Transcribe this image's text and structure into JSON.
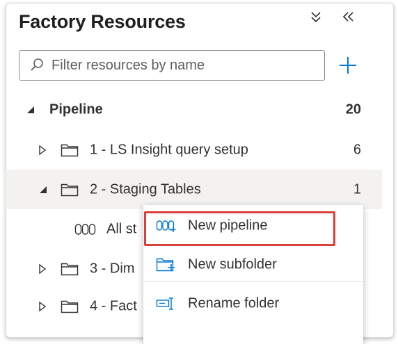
{
  "panel": {
    "title": "Factory Resources",
    "collapse_icon": "chevron-double-down-icon",
    "hide_icon": "chevron-double-left-icon",
    "search": {
      "placeholder": "Filter resources by name",
      "value": ""
    },
    "add_icon": "plus-icon"
  },
  "tree": {
    "root": {
      "label": "Pipeline",
      "count": "20"
    },
    "folders": [
      {
        "label": "1 - LS Insight query setup",
        "count": "6",
        "expanded": false
      },
      {
        "label": "2 - Staging Tables",
        "count": "1",
        "expanded": true
      },
      {
        "label": "3 - Dim",
        "count": "",
        "expanded": false
      },
      {
        "label": "4 - Fact",
        "count": "",
        "expanded": false
      }
    ],
    "child": {
      "label": "All st"
    }
  },
  "context_menu": {
    "items": [
      {
        "label": "New pipeline",
        "icon": "new-pipeline-icon"
      },
      {
        "label": "New subfolder",
        "icon": "new-subfolder-icon"
      },
      {
        "label": "Rename folder",
        "icon": "rename-folder-icon"
      }
    ]
  },
  "colors": {
    "accent": "#0078d4",
    "highlight": "#d9403a",
    "selected_row": "#f3f2f1"
  }
}
